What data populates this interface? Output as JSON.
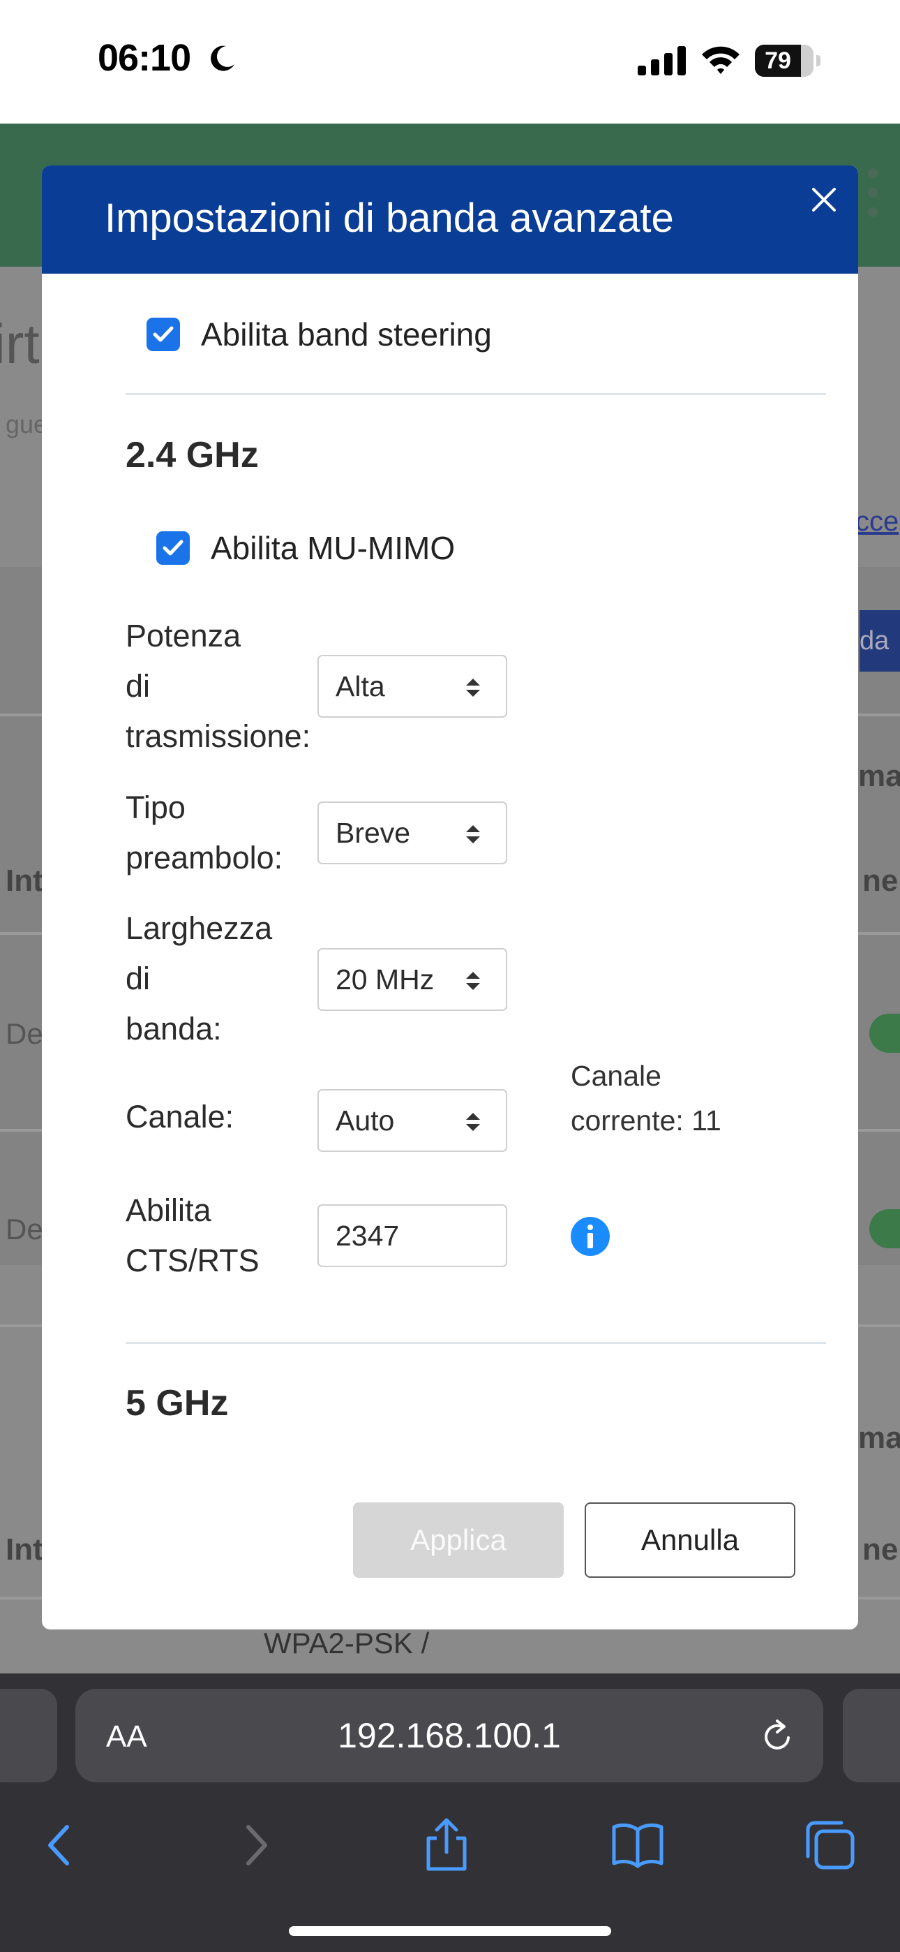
{
  "status_bar": {
    "time": "06:10",
    "battery": "79"
  },
  "background_page": {
    "title_fragment": "irt",
    "subtitle_fragment": "gue",
    "link_fragment": "cce",
    "button_fragment": "da",
    "col_fragment_1": "ma",
    "col_fragment_2": "ne",
    "row_label": "Int",
    "device_fragment": "De",
    "security_text": "WPA2-PSK /"
  },
  "modal": {
    "title": "Impostazioni di banda avanzate",
    "band_steering": {
      "label": "Abilita band steering",
      "checked": true
    },
    "band_24": {
      "heading": "2.4 GHz",
      "mu_mimo": {
        "label": "Abilita MU-MIMO",
        "checked": true
      },
      "tx_power": {
        "label_lines": [
          "Potenza",
          "di",
          "trasmissione:"
        ],
        "value": "Alta"
      },
      "preamble": {
        "label_lines": [
          "Tipo",
          "preambolo:"
        ],
        "value": "Breve"
      },
      "bandwidth": {
        "label_lines": [
          "Larghezza",
          "di",
          "banda:"
        ],
        "value": "20 MHz"
      },
      "channel": {
        "label": "Canale:",
        "value": "Auto",
        "current_lines": [
          "Canale",
          "corrente: 11"
        ]
      },
      "cts_rts": {
        "label_lines": [
          "Abilita",
          "CTS/RTS"
        ],
        "value": "2347"
      }
    },
    "band_5": {
      "heading": "5 GHz"
    },
    "buttons": {
      "apply": "Applica",
      "cancel": "Annulla"
    }
  },
  "browser": {
    "url": "192.168.100.1",
    "text_size_label": "AA"
  },
  "colors": {
    "header": "#0a3d96",
    "checkbox": "#1a73e8",
    "info": "#1a8cff"
  }
}
